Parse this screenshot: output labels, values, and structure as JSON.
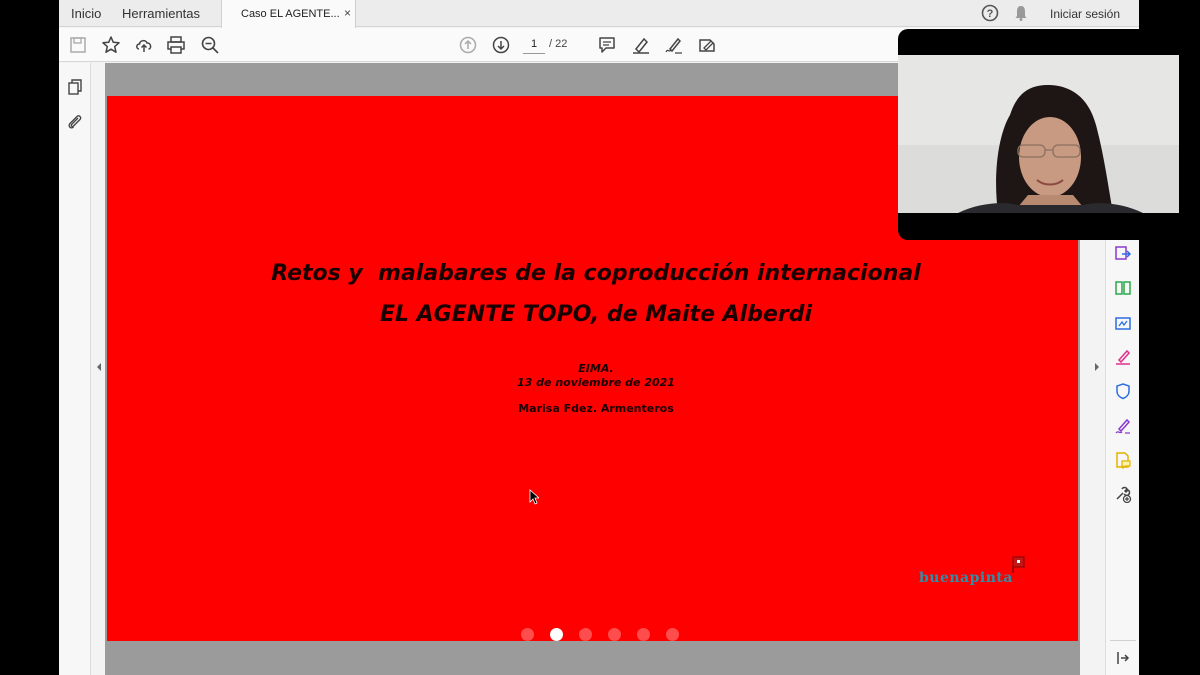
{
  "tabs": {
    "home": "Inicio",
    "tools": "Herramientas",
    "document": "Caso EL AGENTE...",
    "close": "×"
  },
  "account": {
    "sign_in": "Iniciar sesión"
  },
  "toolbar": {
    "current_page": "1",
    "total_pages": "/ 22",
    "icons": [
      "save-icon",
      "star-icon",
      "upload-icon",
      "print-icon",
      "zoom-out-icon",
      "page-up-icon",
      "page-down-icon",
      "comment-icon",
      "highlight-icon",
      "sign-icon",
      "edit-icon"
    ]
  },
  "slide": {
    "title_line1": "Retos y  malabares de la coproducción internacional",
    "title_line2": "EL AGENTE TOPO, de Maite Alberdi",
    "event": "EIMA.",
    "date": "13 de noviembre de 2021",
    "author": "Marisa Fdez. Armenteros",
    "logo": "buenapinta",
    "dots_total": 6,
    "dots_active_index": 1
  },
  "colors": {
    "slide_background": "#ff0000",
    "logo": "#2f8fa8",
    "accent_blue": "#2d6fe0",
    "accent_green": "#2aa84a",
    "accent_pink": "#e0308a",
    "accent_purple": "#8a3ad0",
    "accent_yellow": "#e0b400"
  },
  "right_panel_icons": [
    "export-pdf-icon",
    "organize-pages-icon",
    "create-pdf-icon",
    "fill-sign-icon",
    "protect-icon",
    "edit-pdf-icon",
    "send-review-icon",
    "more-tools-icon",
    "collapse-panel-icon"
  ]
}
